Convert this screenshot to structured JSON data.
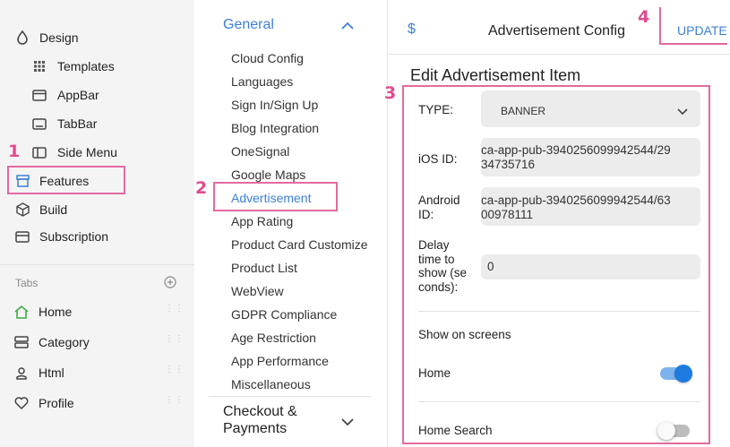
{
  "sidebar": {
    "design": "Design",
    "templates": "Templates",
    "appbar": "AppBar",
    "tabbar": "TabBar",
    "side_menu": "Side Menu",
    "features": "Features",
    "build": "Build",
    "subscription": "Subscription",
    "tabs_header": "Tabs",
    "tabs": [
      "Home",
      "Category",
      "Html",
      "Profile"
    ]
  },
  "menu": {
    "section_title": "General",
    "items": [
      "Cloud Config",
      "Languages",
      "Sign In/Sign Up",
      "Blog Integration",
      "OneSignal",
      "Google Maps",
      "Advertisement",
      "App Rating",
      "Product Card Customize",
      "Product List",
      "WebView",
      "GDPR Compliance",
      "Age Restriction",
      "App Performance",
      "Miscellaneous"
    ],
    "next_section_line1": "Checkout &",
    "next_section_line2": "Payments"
  },
  "header": {
    "icon_glyph": "$",
    "title": "Advertisement Config",
    "update_label": "UPDATE"
  },
  "form": {
    "title": "Edit Advertisement Item",
    "type_label": "TYPE:",
    "type_value": "BANNER",
    "ios_label": "iOS ID:",
    "ios_value_line1": "ca-app-pub-3940256099942544/29",
    "ios_value_line2": "34735716",
    "android_label_line1": "Android",
    "android_label_line2": "ID:",
    "android_value_line1": "ca-app-pub-3940256099942544/63",
    "android_value_line2": "00978111",
    "delay_label_lines": [
      "Delay",
      "time to",
      "show (se",
      "conds):"
    ],
    "delay_value": "0",
    "show_on_screens": "Show on screens",
    "screens": [
      {
        "name": "Home",
        "enabled": true
      },
      {
        "name": "Home Search",
        "enabled": false
      }
    ]
  },
  "markers": [
    "1",
    "2",
    "3",
    "4"
  ],
  "colors": {
    "accent_blue": "#3d7fd9",
    "highlight_pink": "#e26aa0",
    "toggle_on": "#1e7be0",
    "home_icon_green": "#3cb043"
  }
}
